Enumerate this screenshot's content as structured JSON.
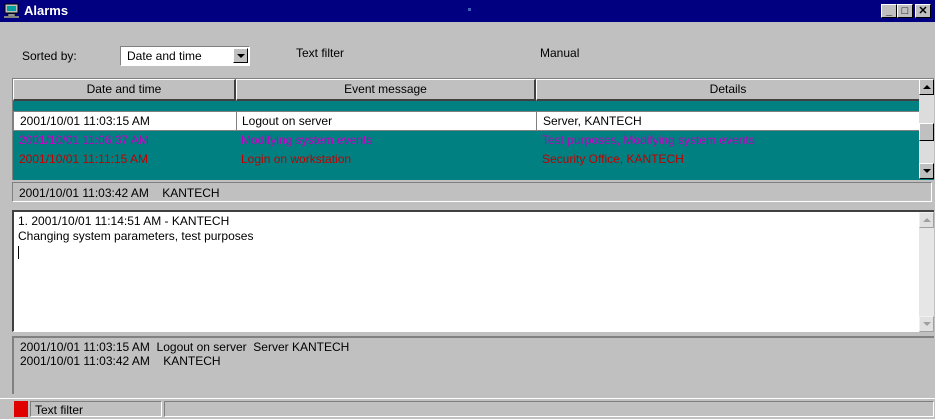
{
  "window": {
    "title": "Alarms",
    "controls": {
      "minimize": "_",
      "maximize": "□",
      "close": "✕"
    }
  },
  "toolbar": {
    "sorted_by_label": "Sorted by:",
    "sort_value": "Date and time",
    "text_filter_label": "Text filter",
    "manual_label": "Manual"
  },
  "grid": {
    "columns": [
      "Date and time",
      "Event message",
      "Details"
    ],
    "rows": [
      {
        "date": "2001/10/01 11:03:15 AM",
        "message": "Logout on server",
        "details": "Server, KANTECH"
      },
      {
        "date": "2001/10/01 11:06:37 AM",
        "message": "Modifying system events",
        "details": "Test purposes, Modifying system events"
      },
      {
        "date": "2001/10/01 11:11:15 AM",
        "message": "Login on workstation",
        "details": "Security Office, KANTECH"
      }
    ],
    "colors": {
      "background": "#008080",
      "row_magenta": "#c000c0",
      "row_red": "#c00000"
    }
  },
  "selected": {
    "text": "2001/10/01 11:03:42 AM    KANTECH"
  },
  "editor": {
    "lines": [
      "1. 2001/10/01 11:14:51 AM - KANTECH",
      "Changing system parameters, test purposes"
    ]
  },
  "log": {
    "lines": [
      "2001/10/01 11:03:15 AM  Logout on server  Server KANTECH",
      "2001/10/01 11:03:42 AM    KANTECH"
    ]
  },
  "statusbar": {
    "panel1": "Text filter",
    "indicator_color": "#e00000"
  }
}
